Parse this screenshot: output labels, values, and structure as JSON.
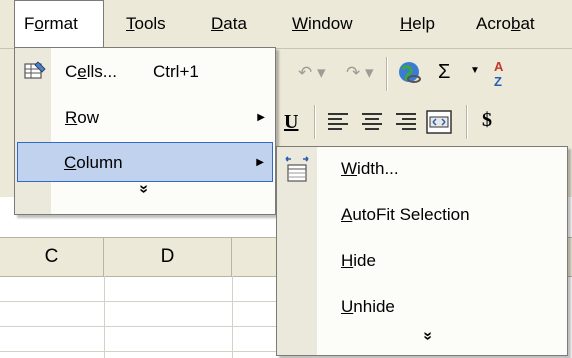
{
  "menubar": {
    "format": "Format",
    "tools": "Tools",
    "data": "Data",
    "window": "Window",
    "help": "Help",
    "acrobat": "Acrobat"
  },
  "format_menu": {
    "cells": {
      "label": "Cells...",
      "shortcut": "Ctrl+1",
      "icon": "format-cells-icon"
    },
    "row": {
      "label": "Row",
      "icon": "submenu-arrow-icon"
    },
    "column": {
      "label": "Column",
      "icon": "submenu-arrow-icon",
      "selected": true
    },
    "expand_glyph": "»"
  },
  "column_submenu": {
    "width": {
      "label": "Width...",
      "icon": "column-width-icon"
    },
    "autofit": "AutoFit Selection",
    "hide": "Hide",
    "unhide": "Unhide",
    "expand_glyph": "»"
  },
  "toolbar": {
    "underline_label": "U",
    "sum_symbol": "Σ",
    "currency_symbol": "$"
  },
  "sheet": {
    "columns": [
      "C",
      "D",
      ""
    ]
  },
  "colors": {
    "menubar_bg": "#ece9d8",
    "selection_bg": "#c1d2ee",
    "selection_border": "#316ac5"
  }
}
